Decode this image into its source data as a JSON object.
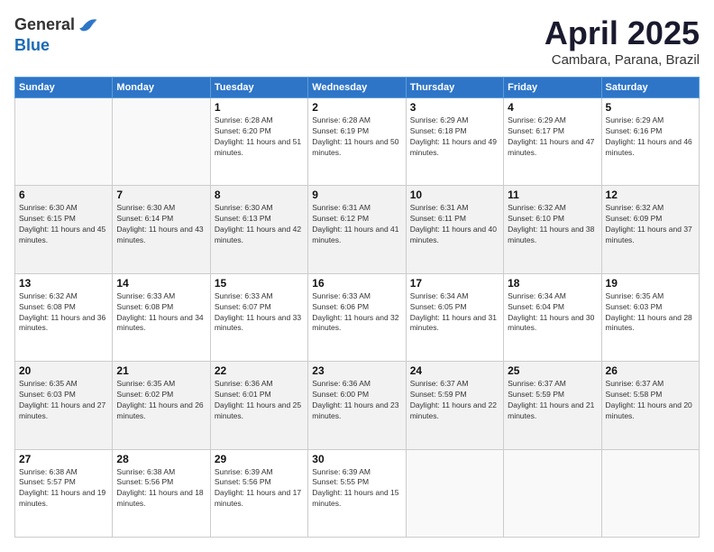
{
  "logo": {
    "general": "General",
    "blue": "Blue"
  },
  "header": {
    "month": "April 2025",
    "location": "Cambara, Parana, Brazil"
  },
  "weekdays": [
    "Sunday",
    "Monday",
    "Tuesday",
    "Wednesday",
    "Thursday",
    "Friday",
    "Saturday"
  ],
  "weeks": [
    [
      {
        "day": "",
        "info": ""
      },
      {
        "day": "",
        "info": ""
      },
      {
        "day": "1",
        "info": "Sunrise: 6:28 AM\nSunset: 6:20 PM\nDaylight: 11 hours and 51 minutes."
      },
      {
        "day": "2",
        "info": "Sunrise: 6:28 AM\nSunset: 6:19 PM\nDaylight: 11 hours and 50 minutes."
      },
      {
        "day": "3",
        "info": "Sunrise: 6:29 AM\nSunset: 6:18 PM\nDaylight: 11 hours and 49 minutes."
      },
      {
        "day": "4",
        "info": "Sunrise: 6:29 AM\nSunset: 6:17 PM\nDaylight: 11 hours and 47 minutes."
      },
      {
        "day": "5",
        "info": "Sunrise: 6:29 AM\nSunset: 6:16 PM\nDaylight: 11 hours and 46 minutes."
      }
    ],
    [
      {
        "day": "6",
        "info": "Sunrise: 6:30 AM\nSunset: 6:15 PM\nDaylight: 11 hours and 45 minutes."
      },
      {
        "day": "7",
        "info": "Sunrise: 6:30 AM\nSunset: 6:14 PM\nDaylight: 11 hours and 43 minutes."
      },
      {
        "day": "8",
        "info": "Sunrise: 6:30 AM\nSunset: 6:13 PM\nDaylight: 11 hours and 42 minutes."
      },
      {
        "day": "9",
        "info": "Sunrise: 6:31 AM\nSunset: 6:12 PM\nDaylight: 11 hours and 41 minutes."
      },
      {
        "day": "10",
        "info": "Sunrise: 6:31 AM\nSunset: 6:11 PM\nDaylight: 11 hours and 40 minutes."
      },
      {
        "day": "11",
        "info": "Sunrise: 6:32 AM\nSunset: 6:10 PM\nDaylight: 11 hours and 38 minutes."
      },
      {
        "day": "12",
        "info": "Sunrise: 6:32 AM\nSunset: 6:09 PM\nDaylight: 11 hours and 37 minutes."
      }
    ],
    [
      {
        "day": "13",
        "info": "Sunrise: 6:32 AM\nSunset: 6:08 PM\nDaylight: 11 hours and 36 minutes."
      },
      {
        "day": "14",
        "info": "Sunrise: 6:33 AM\nSunset: 6:08 PM\nDaylight: 11 hours and 34 minutes."
      },
      {
        "day": "15",
        "info": "Sunrise: 6:33 AM\nSunset: 6:07 PM\nDaylight: 11 hours and 33 minutes."
      },
      {
        "day": "16",
        "info": "Sunrise: 6:33 AM\nSunset: 6:06 PM\nDaylight: 11 hours and 32 minutes."
      },
      {
        "day": "17",
        "info": "Sunrise: 6:34 AM\nSunset: 6:05 PM\nDaylight: 11 hours and 31 minutes."
      },
      {
        "day": "18",
        "info": "Sunrise: 6:34 AM\nSunset: 6:04 PM\nDaylight: 11 hours and 30 minutes."
      },
      {
        "day": "19",
        "info": "Sunrise: 6:35 AM\nSunset: 6:03 PM\nDaylight: 11 hours and 28 minutes."
      }
    ],
    [
      {
        "day": "20",
        "info": "Sunrise: 6:35 AM\nSunset: 6:03 PM\nDaylight: 11 hours and 27 minutes."
      },
      {
        "day": "21",
        "info": "Sunrise: 6:35 AM\nSunset: 6:02 PM\nDaylight: 11 hours and 26 minutes."
      },
      {
        "day": "22",
        "info": "Sunrise: 6:36 AM\nSunset: 6:01 PM\nDaylight: 11 hours and 25 minutes."
      },
      {
        "day": "23",
        "info": "Sunrise: 6:36 AM\nSunset: 6:00 PM\nDaylight: 11 hours and 23 minutes."
      },
      {
        "day": "24",
        "info": "Sunrise: 6:37 AM\nSunset: 5:59 PM\nDaylight: 11 hours and 22 minutes."
      },
      {
        "day": "25",
        "info": "Sunrise: 6:37 AM\nSunset: 5:59 PM\nDaylight: 11 hours and 21 minutes."
      },
      {
        "day": "26",
        "info": "Sunrise: 6:37 AM\nSunset: 5:58 PM\nDaylight: 11 hours and 20 minutes."
      }
    ],
    [
      {
        "day": "27",
        "info": "Sunrise: 6:38 AM\nSunset: 5:57 PM\nDaylight: 11 hours and 19 minutes."
      },
      {
        "day": "28",
        "info": "Sunrise: 6:38 AM\nSunset: 5:56 PM\nDaylight: 11 hours and 18 minutes."
      },
      {
        "day": "29",
        "info": "Sunrise: 6:39 AM\nSunset: 5:56 PM\nDaylight: 11 hours and 17 minutes."
      },
      {
        "day": "30",
        "info": "Sunrise: 6:39 AM\nSunset: 5:55 PM\nDaylight: 11 hours and 15 minutes."
      },
      {
        "day": "",
        "info": ""
      },
      {
        "day": "",
        "info": ""
      },
      {
        "day": "",
        "info": ""
      }
    ]
  ]
}
